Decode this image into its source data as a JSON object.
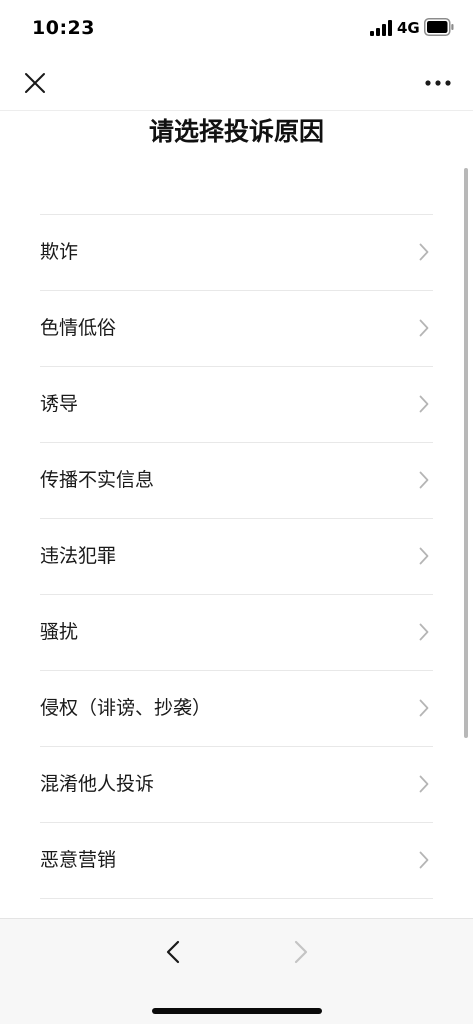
{
  "status_bar": {
    "time": "10:23",
    "network": "4G",
    "signal_icon": "cellular-signal-icon",
    "battery_icon": "battery-icon"
  },
  "nav": {
    "close_icon": "close-icon",
    "more_icon": "more-dots-icon"
  },
  "page": {
    "title": "请选择投诉原因"
  },
  "reasons": [
    {
      "label": "欺诈"
    },
    {
      "label": "色情低俗"
    },
    {
      "label": "诱导"
    },
    {
      "label": "传播不实信息"
    },
    {
      "label": "违法犯罪"
    },
    {
      "label": "骚扰"
    },
    {
      "label": "侵权（诽谤、抄袭）"
    },
    {
      "label": "混淆他人投诉"
    },
    {
      "label": "恶意营销"
    }
  ],
  "toolbar": {
    "back_icon": "chevron-left-icon",
    "forward_icon": "chevron-right-icon",
    "forward_enabled": false
  },
  "colors": {
    "text": "#1a1a1a",
    "divider": "#e8e8e8",
    "chevron": "#b5b5b5",
    "toolbar_bg": "#f7f7f7",
    "disabled_icon": "#c4c4c4"
  }
}
